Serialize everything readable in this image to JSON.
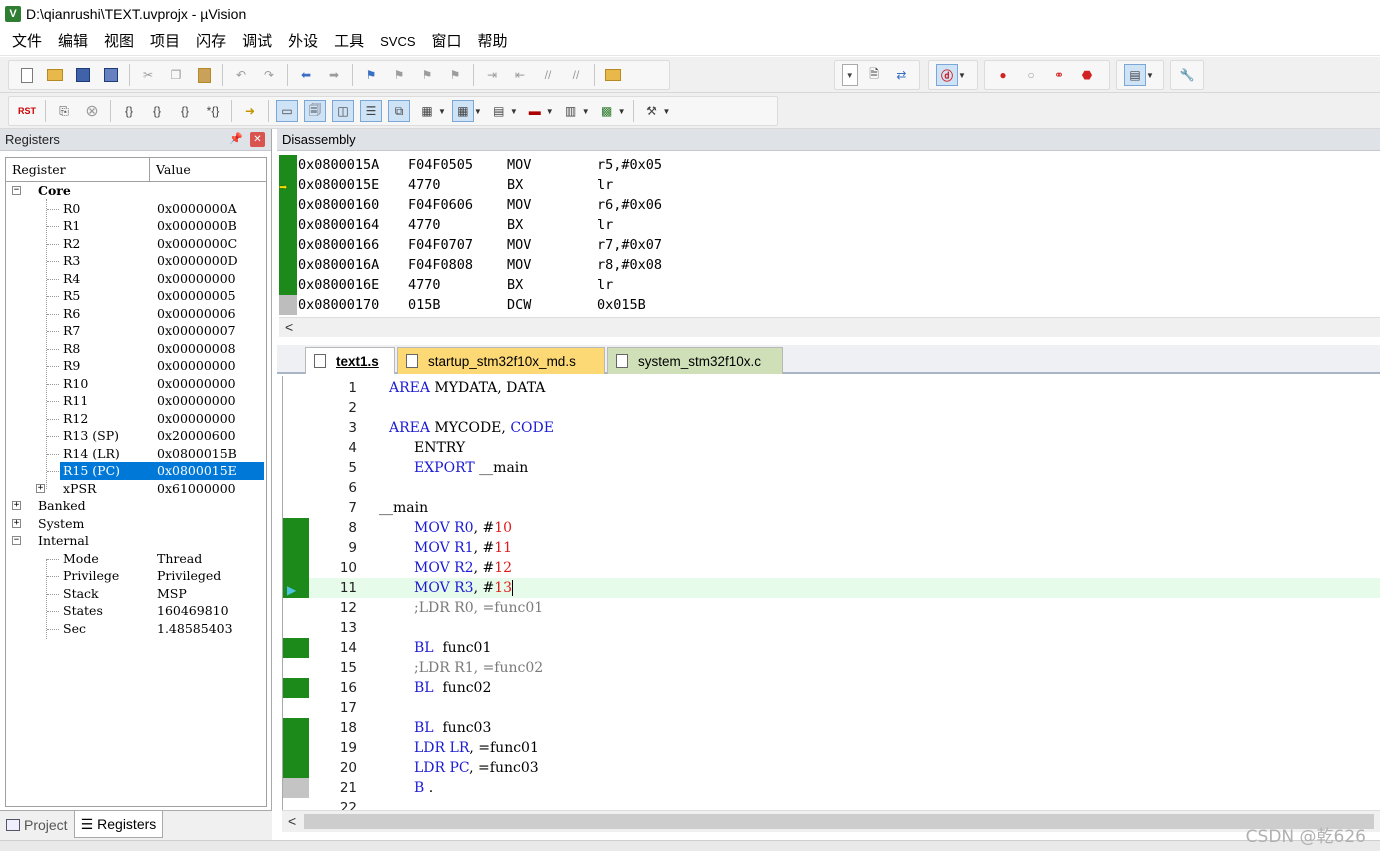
{
  "window": {
    "title": "D:\\qianrushi\\TEXT.uvprojx - µVision",
    "icon_text": "V"
  },
  "menu": [
    "文件",
    "编辑",
    "视图",
    "项目",
    "闪存",
    "调试",
    "外设",
    "工具",
    "SVCS",
    "窗口",
    "帮助"
  ],
  "toolbar2": {
    "reset_label": "RST"
  },
  "registers": {
    "panel_title": "Registers",
    "header": {
      "register": "Register",
      "value": "Value"
    },
    "core_label": "Core",
    "core": [
      {
        "name": "R0",
        "value": "0x0000000A"
      },
      {
        "name": "R1",
        "value": "0x0000000B"
      },
      {
        "name": "R2",
        "value": "0x0000000C"
      },
      {
        "name": "R3",
        "value": "0x0000000D"
      },
      {
        "name": "R4",
        "value": "0x00000000"
      },
      {
        "name": "R5",
        "value": "0x00000005"
      },
      {
        "name": "R6",
        "value": "0x00000006"
      },
      {
        "name": "R7",
        "value": "0x00000007"
      },
      {
        "name": "R8",
        "value": "0x00000008"
      },
      {
        "name": "R9",
        "value": "0x00000000"
      },
      {
        "name": "R10",
        "value": "0x00000000"
      },
      {
        "name": "R11",
        "value": "0x00000000"
      },
      {
        "name": "R12",
        "value": "0x00000000"
      },
      {
        "name": "R13 (SP)",
        "value": "0x20000600"
      },
      {
        "name": "R14 (LR)",
        "value": "0x0800015B"
      },
      {
        "name": "R15 (PC)",
        "value": "0x0800015E"
      },
      {
        "name": "xPSR",
        "value": "0x61000000"
      }
    ],
    "groups": [
      "Banked",
      "System",
      "Internal"
    ],
    "internal": [
      {
        "name": "Mode",
        "value": "Thread"
      },
      {
        "name": "Privilege",
        "value": "Privileged"
      },
      {
        "name": "Stack",
        "value": "MSP"
      },
      {
        "name": "States",
        "value": "160469810"
      },
      {
        "name": "Sec",
        "value": "1.48585403"
      }
    ]
  },
  "left_tabs": {
    "project": "Project",
    "registers": "Registers"
  },
  "disassembly": {
    "title": "Disassembly",
    "rows": [
      {
        "addr": "0x0800015A",
        "hex": "F04F0505",
        "op": "MOV",
        "arg": "r5,#0x05"
      },
      {
        "addr": "0x0800015E",
        "hex": "4770",
        "op": "BX",
        "arg": "lr"
      },
      {
        "addr": "0x08000160",
        "hex": "F04F0606",
        "op": "MOV",
        "arg": "r6,#0x06"
      },
      {
        "addr": "0x08000164",
        "hex": "4770",
        "op": "BX",
        "arg": "lr"
      },
      {
        "addr": "0x08000166",
        "hex": "F04F0707",
        "op": "MOV",
        "arg": "r7,#0x07"
      },
      {
        "addr": "0x0800016A",
        "hex": "F04F0808",
        "op": "MOV",
        "arg": "r8,#0x08"
      },
      {
        "addr": "0x0800016E",
        "hex": "4770",
        "op": "BX",
        "arg": "lr"
      },
      {
        "addr": "0x08000170",
        "hex": "015B",
        "op": "DCW",
        "arg": "0x015B"
      }
    ],
    "scroll_left": "<"
  },
  "editor_tabs": [
    "text1.s",
    "startup_stm32f10x_md.s",
    "system_stm32f10x.c"
  ],
  "code_lines": {
    "l1": "1",
    "l2": "2",
    "l3": "3",
    "l4": "4",
    "l5": "5",
    "l6": "6",
    "l7": "7",
    "l8": "8",
    "l9": "9",
    "l10": "10",
    "l11": "11",
    "l12": "12",
    "l13": "13",
    "l14": "14",
    "l15": "15",
    "l16": "16",
    "l17": "17",
    "l18": "18",
    "l19": "19",
    "l20": "20",
    "l21": "21",
    "l22": "22"
  },
  "code": {
    "area": "AREA",
    "mydata": " MYDATA, DATA",
    "mycode": " MYCODE, ",
    "code_kw": "CODE",
    "entry": "ENTRY",
    "export": "EXPORT",
    "export_arg": " __main",
    "main_label": "__main",
    "mov": "MOV",
    "r0": "R0",
    "r1": "R1",
    "r2": "R2",
    "r3": "R3",
    "hash": ", #",
    "n10": "10",
    "n11": "11",
    "n12": "12",
    "n13": "13",
    "c12": ";LDR R0, =func01",
    "bl": "BL",
    "func01": "  func01",
    "c15": ";LDR R1, =func02",
    "func02": "  func02",
    "func03": "  func03",
    "ldr": "LDR",
    "lr": "LR",
    "pc": "PC",
    "eq_func01": ", =func01",
    "eq_func03": ", =func03",
    "b": "B",
    "dot": " ."
  },
  "watermark": "CSDN @乾626"
}
